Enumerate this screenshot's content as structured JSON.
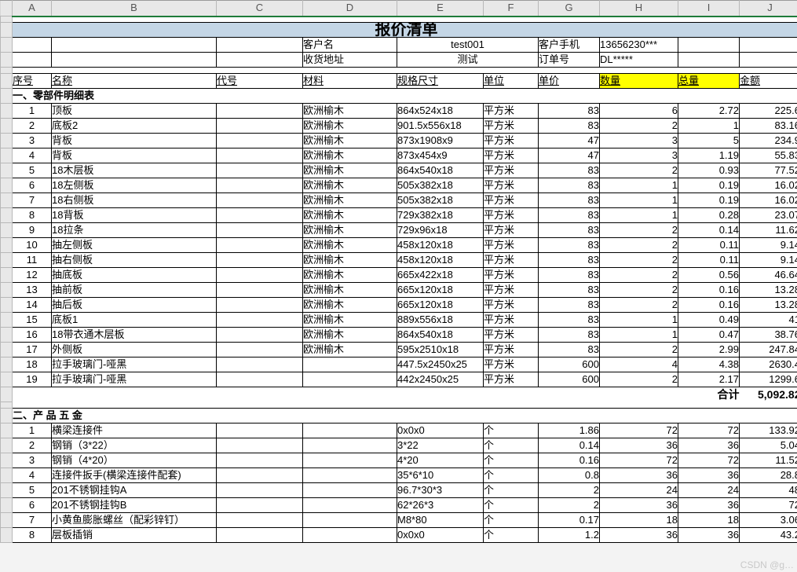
{
  "columns": [
    "A",
    "B",
    "C",
    "D",
    "E",
    "F",
    "G",
    "H",
    "I",
    "J"
  ],
  "title": "报价清单",
  "info": {
    "customer_name_label": "客户名",
    "customer_name_value": "test001",
    "customer_phone_label": "客户手机",
    "customer_phone_value": "13656230***",
    "ship_addr_label": "收货地址",
    "ship_addr_value": "测试",
    "order_no_label": "订单号",
    "order_no_value": "DL*****"
  },
  "headers": {
    "seq": "序号",
    "name": "名称",
    "code": "代号",
    "material": "材料",
    "spec": "规格尺寸",
    "unit": "单位",
    "price": "单价",
    "qty": "数量",
    "total_qty": "总量",
    "amount": "金额"
  },
  "section1_title": "一、零部件明细表",
  "section1_rows": [
    {
      "seq": "1",
      "name": "顶板",
      "code": "",
      "mat": "欧洲榆木",
      "spec": "864x524x18",
      "unit": "平方米",
      "price": "83",
      "qty": "6",
      "tqty": "2.72",
      "amt": "225.6"
    },
    {
      "seq": "2",
      "name": "底板2",
      "code": "",
      "mat": "欧洲榆木",
      "spec": "901.5x556x18",
      "unit": "平方米",
      "price": "83",
      "qty": "2",
      "tqty": "1",
      "amt": "83.16"
    },
    {
      "seq": "3",
      "name": "背板",
      "code": "",
      "mat": "欧洲榆木",
      "spec": "873x1908x9",
      "unit": "平方米",
      "price": "47",
      "qty": "3",
      "tqty": "5",
      "amt": "234.9"
    },
    {
      "seq": "4",
      "name": "背板",
      "code": "",
      "mat": "欧洲榆木",
      "spec": "873x454x9",
      "unit": "平方米",
      "price": "47",
      "qty": "3",
      "tqty": "1.19",
      "amt": "55.83"
    },
    {
      "seq": "5",
      "name": "18木层板",
      "code": "",
      "mat": "欧洲榆木",
      "spec": "864x540x18",
      "unit": "平方米",
      "price": "83",
      "qty": "2",
      "tqty": "0.93",
      "amt": "77.52"
    },
    {
      "seq": "6",
      "name": "18左侧板",
      "code": "",
      "mat": "欧洲榆木",
      "spec": "505x382x18",
      "unit": "平方米",
      "price": "83",
      "qty": "1",
      "tqty": "0.19",
      "amt": "16.02"
    },
    {
      "seq": "7",
      "name": "18右侧板",
      "code": "",
      "mat": "欧洲榆木",
      "spec": "505x382x18",
      "unit": "平方米",
      "price": "83",
      "qty": "1",
      "tqty": "0.19",
      "amt": "16.02"
    },
    {
      "seq": "8",
      "name": "18背板",
      "code": "",
      "mat": "欧洲榆木",
      "spec": "729x382x18",
      "unit": "平方米",
      "price": "83",
      "qty": "1",
      "tqty": "0.28",
      "amt": "23.07"
    },
    {
      "seq": "9",
      "name": "18拉条",
      "code": "",
      "mat": "欧洲榆木",
      "spec": "729x96x18",
      "unit": "平方米",
      "price": "83",
      "qty": "2",
      "tqty": "0.14",
      "amt": "11.62"
    },
    {
      "seq": "10",
      "name": "抽左侧板",
      "code": "",
      "mat": "欧洲榆木",
      "spec": "458x120x18",
      "unit": "平方米",
      "price": "83",
      "qty": "2",
      "tqty": "0.11",
      "amt": "9.14"
    },
    {
      "seq": "11",
      "name": "抽右侧板",
      "code": "",
      "mat": "欧洲榆木",
      "spec": "458x120x18",
      "unit": "平方米",
      "price": "83",
      "qty": "2",
      "tqty": "0.11",
      "amt": "9.14"
    },
    {
      "seq": "12",
      "name": "抽底板",
      "code": "",
      "mat": "欧洲榆木",
      "spec": "665x422x18",
      "unit": "平方米",
      "price": "83",
      "qty": "2",
      "tqty": "0.56",
      "amt": "46.64"
    },
    {
      "seq": "13",
      "name": "抽前板",
      "code": "",
      "mat": "欧洲榆木",
      "spec": "665x120x18",
      "unit": "平方米",
      "price": "83",
      "qty": "2",
      "tqty": "0.16",
      "amt": "13.28"
    },
    {
      "seq": "14",
      "name": "抽后板",
      "code": "",
      "mat": "欧洲榆木",
      "spec": "665x120x18",
      "unit": "平方米",
      "price": "83",
      "qty": "2",
      "tqty": "0.16",
      "amt": "13.28"
    },
    {
      "seq": "15",
      "name": "底板1",
      "code": "",
      "mat": "欧洲榆木",
      "spec": "889x556x18",
      "unit": "平方米",
      "price": "83",
      "qty": "1",
      "tqty": "0.49",
      "amt": "41"
    },
    {
      "seq": "16",
      "name": "18带衣通木层板",
      "code": "",
      "mat": "欧洲榆木",
      "spec": "864x540x18",
      "unit": "平方米",
      "price": "83",
      "qty": "1",
      "tqty": "0.47",
      "amt": "38.76"
    },
    {
      "seq": "17",
      "name": "外侧板",
      "code": "",
      "mat": "欧洲榆木",
      "spec": "595x2510x18",
      "unit": "平方米",
      "price": "83",
      "qty": "2",
      "tqty": "2.99",
      "amt": "247.84"
    },
    {
      "seq": "18",
      "name": "拉手玻璃门-哑黑",
      "code": "",
      "mat": "",
      "spec": "447.5x2450x25",
      "unit": "平方米",
      "price": "600",
      "qty": "4",
      "tqty": "4.38",
      "amt": "2630.4"
    },
    {
      "seq": "19",
      "name": "拉手玻璃门-哑黑",
      "code": "",
      "mat": "",
      "spec": "442x2450x25",
      "unit": "平方米",
      "price": "600",
      "qty": "2",
      "tqty": "2.17",
      "amt": "1299.6"
    }
  ],
  "section1_sum_label": "合计",
  "section1_sum_value": "5,092.82",
  "section2_title": "二、产 品 五 金",
  "section2_rows": [
    {
      "seq": "1",
      "name": "横梁连接件",
      "code": "",
      "mat": "",
      "spec": "0x0x0",
      "unit": "个",
      "price": "1.86",
      "qty": "72",
      "tqty": "72",
      "amt": "133.92"
    },
    {
      "seq": "2",
      "name": "钢销（3*22）",
      "code": "",
      "mat": "",
      "spec": "3*22",
      "unit": "个",
      "price": "0.14",
      "qty": "36",
      "tqty": "36",
      "amt": "5.04"
    },
    {
      "seq": "3",
      "name": "钢销（4*20）",
      "code": "",
      "mat": "",
      "spec": "4*20",
      "unit": "个",
      "price": "0.16",
      "qty": "72",
      "tqty": "72",
      "amt": "11.52"
    },
    {
      "seq": "4",
      "name": "连接件扳手(横梁连接件配套)",
      "code": "",
      "mat": "",
      "spec": "35*6*10",
      "unit": "个",
      "price": "0.8",
      "qty": "36",
      "tqty": "36",
      "amt": "28.8"
    },
    {
      "seq": "5",
      "name": "201不锈钢挂钩A",
      "code": "",
      "mat": "",
      "spec": "96.7*30*3",
      "unit": "个",
      "price": "2",
      "qty": "24",
      "tqty": "24",
      "amt": "48"
    },
    {
      "seq": "6",
      "name": "201不锈钢挂钩B",
      "code": "",
      "mat": "",
      "spec": "62*26*3",
      "unit": "个",
      "price": "2",
      "qty": "36",
      "tqty": "36",
      "amt": "72"
    },
    {
      "seq": "7",
      "name": "小黄鱼膨胀螺丝（配彩锌钉）",
      "code": "",
      "mat": "",
      "spec": "M8*80",
      "unit": "个",
      "price": "0.17",
      "qty": "18",
      "tqty": "18",
      "amt": "3.06"
    },
    {
      "seq": "8",
      "name": "层板插销",
      "code": "",
      "mat": "",
      "spec": "0x0x0",
      "unit": "个",
      "price": "1.2",
      "qty": "36",
      "tqty": "36",
      "amt": "43.2"
    }
  ],
  "watermark": "CSDN @g…"
}
